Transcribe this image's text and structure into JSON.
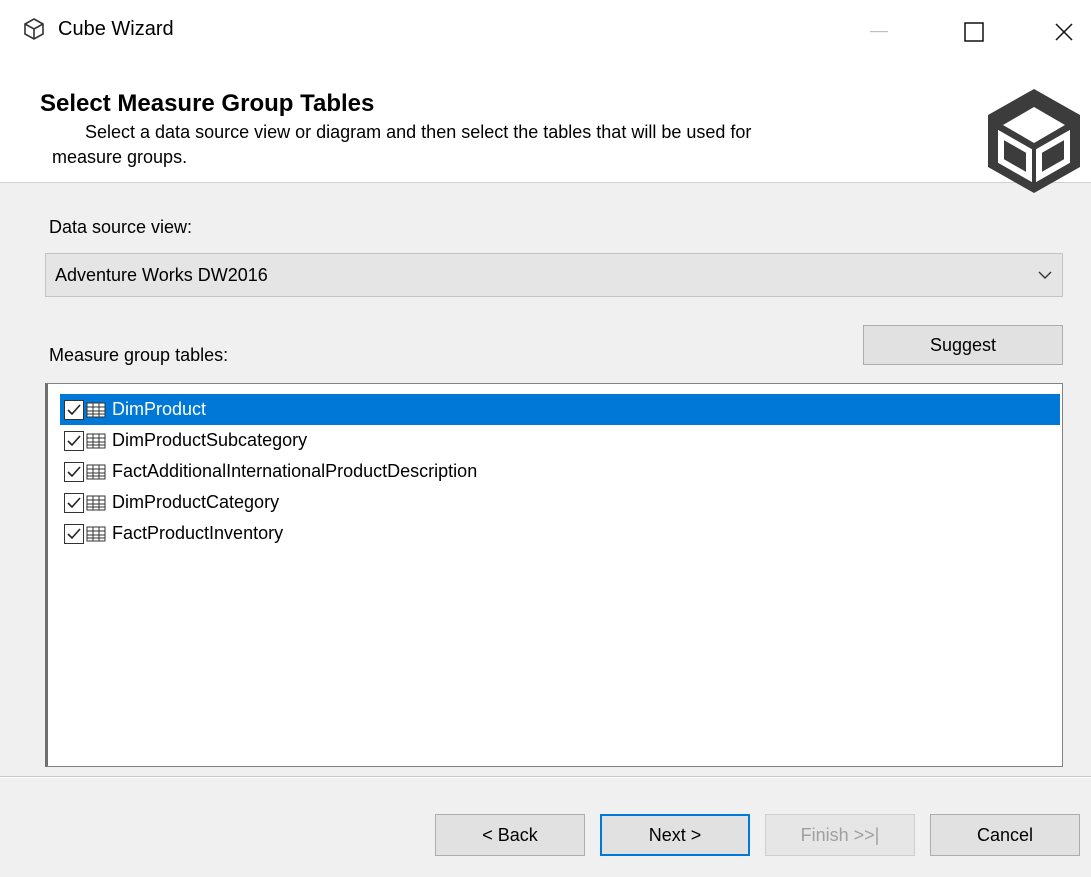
{
  "window": {
    "title": "Cube Wizard"
  },
  "header": {
    "title": "Select Measure Group Tables",
    "description_line1": "Select a data source view or diagram and then select the tables that will be used for",
    "description_line2": "measure groups."
  },
  "datasource": {
    "label": "Data source view:",
    "selected": "Adventure Works DW2016"
  },
  "tables": {
    "label": "Measure group tables:",
    "suggest_label": "Suggest",
    "items": [
      {
        "name": "DimProduct",
        "checked": true,
        "selected": true
      },
      {
        "name": "DimProductSubcategory",
        "checked": true,
        "selected": false
      },
      {
        "name": "FactAdditionalInternationalProductDescription",
        "checked": true,
        "selected": false
      },
      {
        "name": "DimProductCategory",
        "checked": true,
        "selected": false
      },
      {
        "name": "FactProductInventory",
        "checked": true,
        "selected": false
      }
    ]
  },
  "footer": {
    "back_label": "< Back",
    "next_label": "Next >",
    "finish_label": "Finish >>|",
    "cancel_label": "Cancel"
  },
  "colors": {
    "selection": "#0078d7",
    "disabled_text": "#a0a0a0",
    "default_button_border": "#0078d7"
  }
}
